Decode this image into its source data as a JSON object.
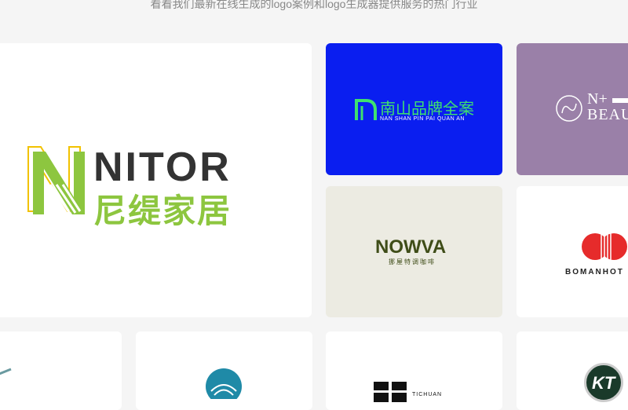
{
  "header": {
    "subtitle": "看看我们最新在线生成的logo案例和logo生成器提供服务的热门行业"
  },
  "cards": {
    "nitor": {
      "name": "NITOR",
      "cn": "尼缇家居",
      "accent": "#8dc63f",
      "outline": "#f2c200"
    },
    "nanshan": {
      "cn": "南山品牌全案",
      "en": "NAN SHAN PIN PAI QUAN AN",
      "bg": "#0a1ef0",
      "accent": "#3fe06f"
    },
    "beauty": {
      "line1": "N+",
      "line2": "BEAU",
      "bg": "#9a80a8"
    },
    "nowva": {
      "name": "NOWVA",
      "sub": "挪屋特调咖啡",
      "bg": "#ecebe2",
      "accent": "#3f4d18"
    },
    "boman": {
      "name": "BOMANHOT",
      "accent": "#e62b2b"
    },
    "tichuan": {
      "name": "TICHUAN"
    },
    "kt": {
      "name": "KT"
    }
  }
}
